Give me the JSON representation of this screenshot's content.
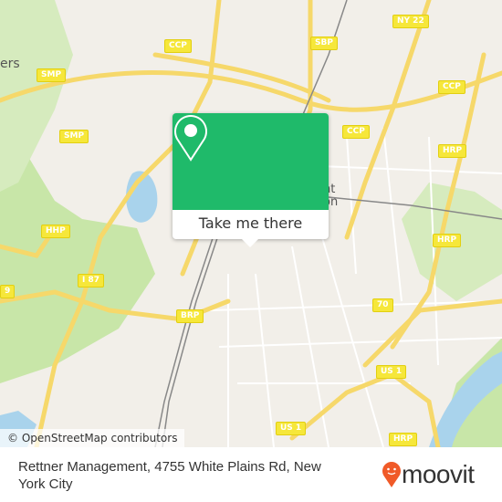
{
  "map": {
    "attribution": "© OpenStreetMap contributors",
    "place_labels": [
      "ers",
      "nt",
      "on"
    ],
    "road_shields": [
      {
        "label": "NY 22"
      },
      {
        "label": "CCP"
      },
      {
        "label": "SBP"
      },
      {
        "label": "SMP"
      },
      {
        "label": "CCP"
      },
      {
        "label": "CCP"
      },
      {
        "label": "SMP"
      },
      {
        "label": "HRP"
      },
      {
        "label": "HHP"
      },
      {
        "label": "HRP"
      },
      {
        "label": "I 87"
      },
      {
        "label": "BRP"
      },
      {
        "label": "70"
      },
      {
        "label": "US 1"
      },
      {
        "label": "US 1"
      },
      {
        "label": "HRP"
      },
      {
        "label": "9"
      }
    ],
    "colors": {
      "land": "#f2efe9",
      "park": "#c8e6a8",
      "water": "#a9d3ec",
      "road": "#f6e27a"
    }
  },
  "popup": {
    "icon": "location-pin-icon",
    "button_label": "Take me there",
    "color": "#1fba6a"
  },
  "footer": {
    "address": "Rettner Management, 4755 White Plains Rd, New York City",
    "logo_text": "moovit",
    "logo_color": "#f05a28"
  }
}
